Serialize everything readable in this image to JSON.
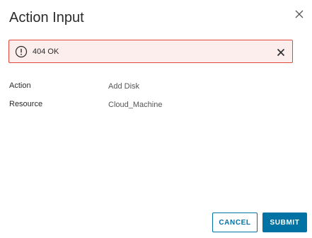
{
  "dialog": {
    "title": "Action Input",
    "close_icon": "close-icon"
  },
  "alert": {
    "icon": "exclamation-circle-icon",
    "message": "404 OK",
    "close_icon": "close-icon",
    "border_color": "#e1473a",
    "background_color": "#fbeeec"
  },
  "details": [
    {
      "label": "Action",
      "value": "Add Disk"
    },
    {
      "label": "Resource",
      "value": "Cloud_Machine"
    }
  ],
  "footer": {
    "cancel_label": "CANCEL",
    "submit_label": "SUBMIT",
    "accent_color": "#0072a3"
  }
}
